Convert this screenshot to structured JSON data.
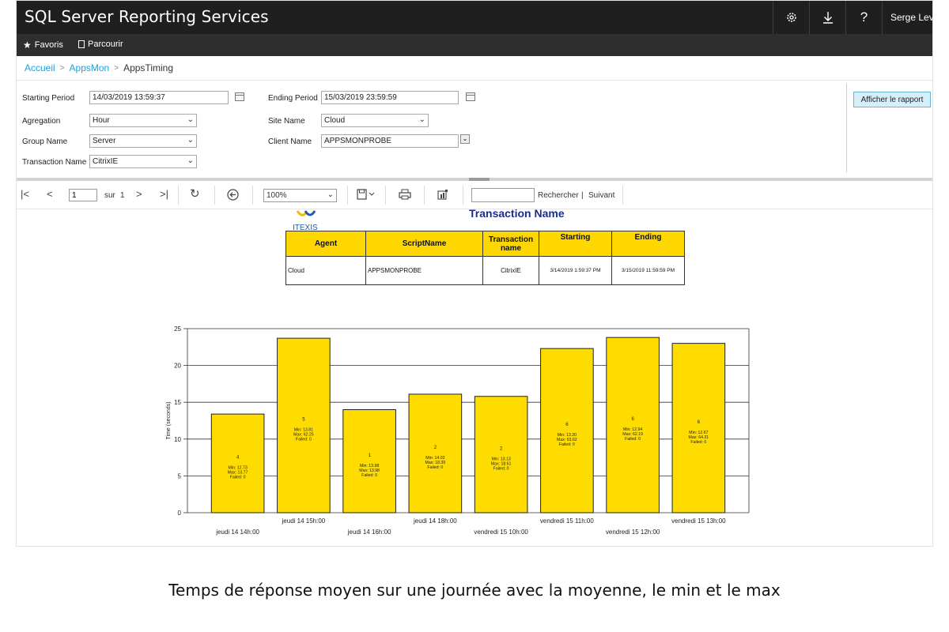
{
  "app": {
    "title": "SQL Server Reporting Services",
    "user": "Serge Levi"
  },
  "topbar_icons": [
    "gear-icon",
    "download-icon",
    "help-icon"
  ],
  "nav": {
    "favorites": "Favoris",
    "browse": "Parcourir"
  },
  "breadcrumb": {
    "home": "Accueil",
    "folder": "AppsMon",
    "current": "AppsTiming"
  },
  "params": {
    "starting_period": {
      "label": "Starting Period",
      "value": "14/03/2019 13:59:37"
    },
    "ending_period": {
      "label": "Ending Period",
      "value": "15/03/2019 23:59:59"
    },
    "agregation": {
      "label": "Agregation",
      "value": "Hour"
    },
    "site_name": {
      "label": "Site Name",
      "value": "Cloud"
    },
    "group_name": {
      "label": "Group Name",
      "value": "Server"
    },
    "client_name": {
      "label": "Client Name",
      "value": "APPSMONPROBE"
    },
    "transaction_name": {
      "label": "Transaction Name",
      "value": "CitrixIE"
    },
    "view_report": "Afficher le rapport"
  },
  "toolbar": {
    "page": "1",
    "of_label": "sur",
    "total_pages": "1",
    "zoom": "100%",
    "find": "Rechercher",
    "separator": "|",
    "next": "Suivant"
  },
  "report": {
    "logo_text": "ITEXIS",
    "title": "Transaction Name",
    "table": {
      "headers": [
        "Agent",
        "ScriptName",
        "Transaction name",
        "Starting",
        "Ending"
      ],
      "row": [
        "Cloud",
        "APPSMONPROBE",
        "CitrixIE",
        "3/14/2019 1:59:37 PM",
        "3/15/2019 11:59:59 PM"
      ]
    }
  },
  "chart_data": {
    "type": "bar",
    "ylabel": "Time (seconds)",
    "xlabel": "",
    "ylim": [
      0,
      25
    ],
    "yticks": [
      0,
      5,
      10,
      15,
      20,
      25
    ],
    "grid": true,
    "bar_color": "#FFDC00",
    "categories": [
      "jeudi 14 14h:00",
      "jeudi 14 15h:00",
      "jeudi 14 16h:00",
      "jeudi 14 18h:00",
      "vendredi 15 10h:00",
      "vendredi 15 11h:00",
      "vendredi 15 12h:00",
      "vendredi 15 13h:00"
    ],
    "values": [
      13.4,
      23.7,
      14.0,
      16.1,
      15.8,
      22.3,
      23.8,
      23.0
    ],
    "bar_labels": [
      [
        "4",
        "Min: 12.73",
        "Max: 13.77",
        "Failed: 0"
      ],
      [
        "5",
        "Min: 13.81",
        "Max: 62.25",
        "Failed: 0"
      ],
      [
        "1",
        "Min: 13.98",
        "Max: 13.98",
        "Failed: 0"
      ],
      [
        "2",
        "Min: 14.02",
        "Max: 18.39",
        "Failed: 0"
      ],
      [
        "2",
        "Min: 13.13",
        "Max: 18.61",
        "Failed: 0"
      ],
      [
        "6",
        "Min: 13.20",
        "Max: 63.62",
        "Failed: 0"
      ],
      [
        "6",
        "Min: 12.94",
        "Max: 62.19",
        "Failed: 0"
      ],
      [
        "6",
        "Min: 12.67",
        "Max: 64.31",
        "Failed: 0"
      ]
    ]
  },
  "caption": "Temps de réponse moyen sur une journée avec la moyenne, le min et le max"
}
